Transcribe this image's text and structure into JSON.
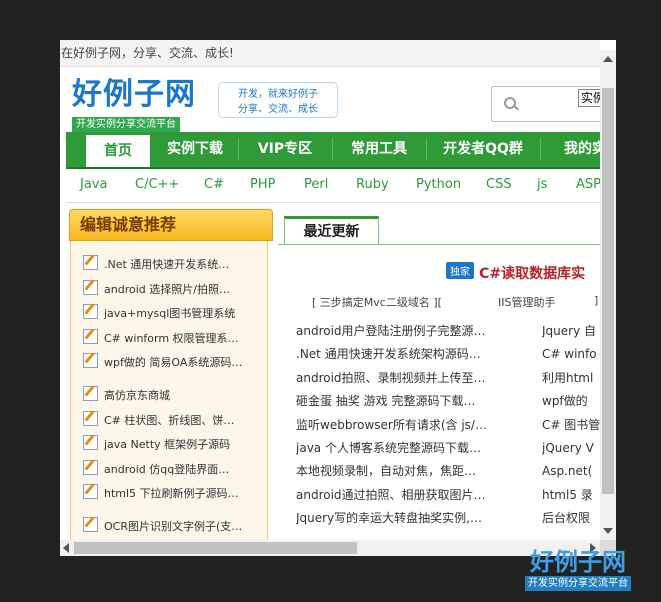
{
  "topbar": {
    "text": "在好例子网，分享、交流、成长!"
  },
  "logo": {
    "main": "好例子网",
    "sub": "开发实例分享交流平台"
  },
  "slogan": {
    "line1": "开发，就来好例子",
    "line2": "分享、交流、成长"
  },
  "search": {
    "button_label": "实例"
  },
  "nav": {
    "items": [
      "首页",
      "实例下载",
      "VIP专区",
      "常用工具",
      "开发者QQ群",
      "我的实"
    ]
  },
  "subnav": {
    "items": [
      "Java",
      "C/C++",
      "C#",
      "PHP",
      "Perl",
      "Ruby",
      "Python",
      "CSS",
      "js",
      "ASP"
    ]
  },
  "left_panel": {
    "title": "编辑诚意推荐",
    "items": [
      ".Net 通用快速开发系统…",
      "android 选择照片/拍照…",
      "java+mysql图书管理系统",
      "C# winform 权限管理系…",
      "wpf做的 简易OA系统源码…",
      "高仿京东商城",
      "C# 柱状图、折线图、饼…",
      "java Netty 框架例子源码",
      "android 仿qq登陆界面…",
      "html5 下拉刷新例子源码…",
      "OCR图片识别文字例子(支…"
    ]
  },
  "main": {
    "tab": "最近更新",
    "featured": {
      "badge": "独家",
      "title": "C#读取数据库实"
    },
    "chips": [
      "[ 三步搞定Mvc二级域名 ][",
      "IIS管理助手",
      "]"
    ],
    "col1": [
      "android用户登陆注册例子完整源…",
      ".Net 通用快速开发系统架构源码…",
      "android拍照、录制视频并上传至…",
      "砸金蛋 抽奖 游戏 完整源码下载…",
      "监听webbrowser所有请求(含 js/…",
      "java 个人博客系统完整源码下载…",
      "本地视频录制，自动对焦，焦距…",
      "android通过拍照、相册获取图片…",
      "Jquery写的幸运大转盘抽奖实例,…"
    ],
    "col2": [
      "Jquery 自",
      "C# winfo",
      "利用html",
      "wpf做的",
      "C# 图书管",
      "jQuery V",
      "Asp.net(",
      "html5 录",
      "后台权限"
    ]
  },
  "watermark": {
    "main": "好例子网",
    "sub": "开发实例分享交流平台"
  },
  "colors": {
    "nav_green": "#2e9a38",
    "brand_blue": "#1b77c9",
    "featured_red": "#b5232b",
    "panel_yellow": "#f7b81a"
  }
}
